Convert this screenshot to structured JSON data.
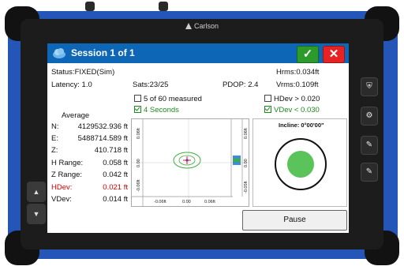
{
  "device": {
    "brand": "Carlson"
  },
  "titlebar": {
    "title": "Session 1 of 1",
    "ok_label": "✓",
    "close_label": "✕"
  },
  "status": {
    "status": "Status:FIXED(Sim)",
    "hrms": "Hrms:0.034ft",
    "latency": "Latency: 1.0",
    "sats": "Sats:23/25",
    "pdop": "PDOP: 2.4",
    "vrms": "Vrms:0.109ft"
  },
  "options": {
    "measured": "5 of 60 measured",
    "seconds": "4 Seconds",
    "hdev_check": "HDev > 0.020",
    "vdev_check": "VDev < 0.030"
  },
  "average": {
    "heading": "Average",
    "rows": [
      {
        "label": "N:",
        "value": "4129532.936 ft"
      },
      {
        "label": "E:",
        "value": "5488714.589 ft"
      },
      {
        "label": "Z:",
        "value": "410.718 ft"
      },
      {
        "label": "H Range:",
        "value": "0.058 ft"
      },
      {
        "label": "Z Range:",
        "value": "0.042 ft"
      },
      {
        "label": "HDev:",
        "value": "0.021 ft"
      },
      {
        "label": "VDev:",
        "value": "0.014 ft"
      }
    ]
  },
  "plot": {
    "x_ticks": [
      "-0.06ft",
      "0.00",
      "0.06ft"
    ],
    "y_ticks": [
      "0.06ft",
      "0.00",
      "-0.06ft"
    ],
    "z_ticks": [
      "0.06ft",
      "0.00",
      "-0.05ft"
    ]
  },
  "incline": {
    "label": "Incline:",
    "value": "0°00'00\""
  },
  "actions": {
    "pause": "Pause"
  },
  "colors": {
    "titlebar": "#0e67b6",
    "accent_green": "#2c9b2c",
    "accent_red": "#e62222",
    "device_blue": "#2456b8"
  }
}
